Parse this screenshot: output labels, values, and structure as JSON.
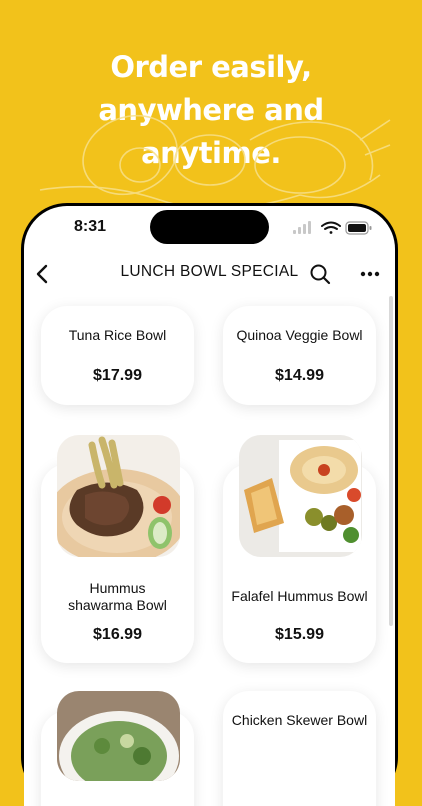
{
  "headline": {
    "line1": "Order easily,",
    "line2": "anywhere and",
    "line3": "anytime."
  },
  "status_bar": {
    "time": "8:31"
  },
  "navbar": {
    "title": "LUNCH BOWL SPECIAL"
  },
  "items": [
    {
      "name": "Tuna Rice Bowl",
      "price": "$17.99"
    },
    {
      "name": "Quinoa Veggie Bowl",
      "price": "$14.99"
    },
    {
      "name_line1": "Hummus",
      "name_line2": "shawarma Bowl",
      "price": "$16.99"
    },
    {
      "name": "Falafel Hummus Bowl",
      "price": "$15.99"
    },
    {
      "name": "Chicken Skewer Bowl"
    }
  ],
  "colors": {
    "background": "#F2C21B",
    "text": "#111111",
    "card": "#FFFFFF"
  },
  "icons": [
    "back-chevron-icon",
    "search-icon",
    "more-dots-icon",
    "wifi-icon",
    "battery-icon",
    "signal-icon"
  ]
}
